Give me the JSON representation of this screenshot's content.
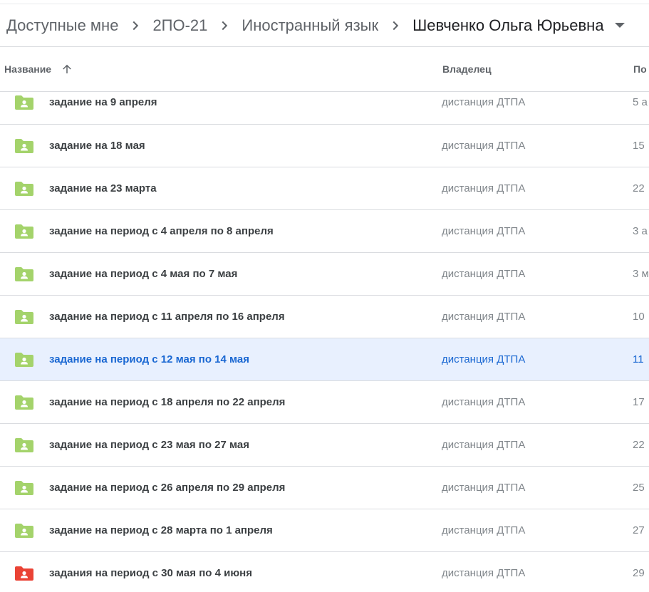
{
  "breadcrumb": {
    "items": [
      "Доступные мне",
      "2ПО-21",
      "Иностранный язык",
      "Шевченко Ольга Юрьевна"
    ]
  },
  "header": {
    "name_label": "Название",
    "owner_label": "Владелец",
    "modified_label": "По",
    "sort_direction": "ascending"
  },
  "colors": {
    "folder_green": "#a4d36b",
    "folder_red": "#ea4335",
    "selected_bg": "#e8f0fe",
    "selected_text": "#1967d2"
  },
  "rows": [
    {
      "name": "задание на 9 апреля",
      "owner": "дистанция ДТПА",
      "modified": "5 а",
      "icon": "shared-folder-icon",
      "color": "#a4d36b"
    },
    {
      "name": "задание на 18 мая",
      "owner": "дистанция ДТПА",
      "modified": "15",
      "icon": "shared-folder-icon",
      "color": "#a4d36b"
    },
    {
      "name": "задание на 23 марта",
      "owner": "дистанция ДТПА",
      "modified": "22",
      "icon": "shared-folder-icon",
      "color": "#a4d36b"
    },
    {
      "name": "задание на период с 4 апреля по 8 апреля",
      "owner": "дистанция ДТПА",
      "modified": "3 а",
      "icon": "shared-folder-icon",
      "color": "#a4d36b"
    },
    {
      "name": "задание на период с 4 мая по 7 мая",
      "owner": "дистанция ДТПА",
      "modified": "3 м",
      "icon": "shared-folder-icon",
      "color": "#a4d36b"
    },
    {
      "name": "задание на период с 11 апреля по 16 апреля",
      "owner": "дистанция ДТПА",
      "modified": "10",
      "icon": "shared-folder-icon",
      "color": "#a4d36b"
    },
    {
      "name": "задание на период с 12 мая по 14 мая",
      "owner": "дистанция ДТПА",
      "modified": "11",
      "icon": "shared-folder-icon",
      "color": "#a4d36b",
      "selected": true
    },
    {
      "name": "задание на период с 18 апреля по 22 апреля",
      "owner": "дистанция ДТПА",
      "modified": "17",
      "icon": "shared-folder-icon",
      "color": "#a4d36b"
    },
    {
      "name": "задание на период с 23 мая по 27 мая",
      "owner": "дистанция ДТПА",
      "modified": "22",
      "icon": "shared-folder-icon",
      "color": "#a4d36b"
    },
    {
      "name": "задание на период с 26 апреля по 29 апреля",
      "owner": "дистанция ДТПА",
      "modified": "25",
      "icon": "shared-folder-icon",
      "color": "#a4d36b"
    },
    {
      "name": "задание на период с 28 марта по 1 апреля",
      "owner": "дистанция ДТПА",
      "modified": "27",
      "icon": "shared-folder-icon",
      "color": "#a4d36b"
    },
    {
      "name": "задания на период с 30 мая по 4 июня",
      "owner": "дистанция ДТПА",
      "modified": "29",
      "icon": "shared-folder-icon",
      "color": "#ea4335"
    }
  ]
}
